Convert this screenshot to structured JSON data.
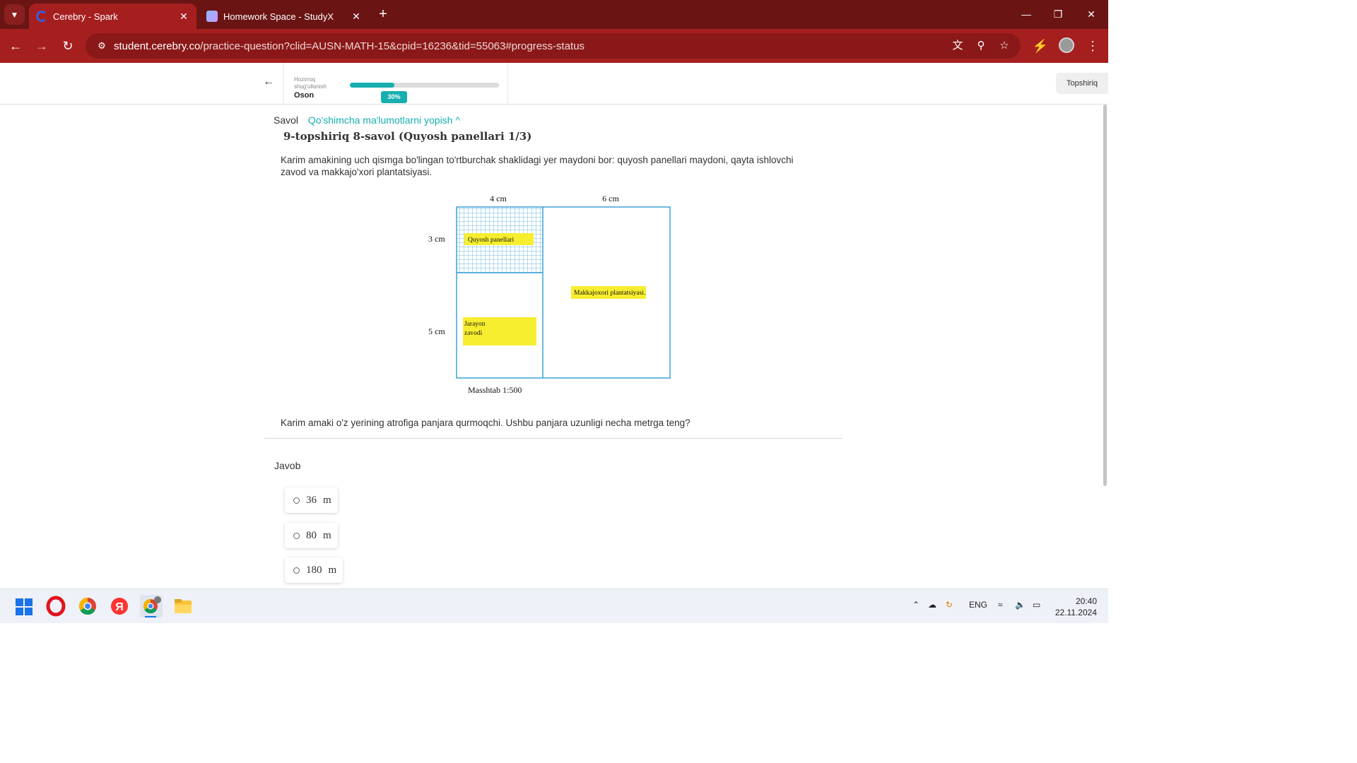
{
  "browser": {
    "tabs": [
      {
        "title": "Cerebry - Spark",
        "active": true
      },
      {
        "title": "Homework Space - StudyX",
        "active": false
      }
    ],
    "url_host": "student.cerebry.co",
    "url_path": "/practice-question?clid=AUSN-MATH-15&cpid=16236&tid=55063#progress-status",
    "accent": "#a61f1f"
  },
  "header": {
    "status_label": "Hozirroq shug'ullanish",
    "level": "Oson",
    "progress_percent": 30,
    "progress_label": "30%",
    "submit_label": "Topshiriq"
  },
  "question": {
    "savol_label": "Savol",
    "toggle_label": "Qo'shimcha ma'lumotlarni yopish ^",
    "title": "9-topshiriq 8-savol (Quyosh panellari 1/3)",
    "text": "Karim amakining uch qismga bo'lingan to'rtburchak shaklidagi yer maydoni bor: quyosh panellari maydoni, qayta ishlovchi zavod va makkajo'xori plantatsiyasi.",
    "ask": "Karim amaki o'z yerining atrofiga panjara qurmoqchi. Ushbu panjara uzunligi necha metrga teng?"
  },
  "diagram": {
    "top_left_width": "4 cm",
    "top_right_width": "6 cm",
    "left_upper_height": "3 cm",
    "left_lower_height": "5 cm",
    "label_solar": "Quyosh panellari",
    "label_factory_1": "Jarayon",
    "label_factory_2": "zavodi",
    "label_corn": "Makkajoxori plantatsiyasi.",
    "scale": "Masshtab 1:500"
  },
  "answer": {
    "label": "Javob",
    "options": [
      {
        "value": "36",
        "unit": "m"
      },
      {
        "value": "80",
        "unit": "m"
      },
      {
        "value": "180",
        "unit": "m"
      }
    ]
  },
  "taskbar": {
    "language": "ENG",
    "time": "20:40",
    "date": "22.11.2024"
  }
}
